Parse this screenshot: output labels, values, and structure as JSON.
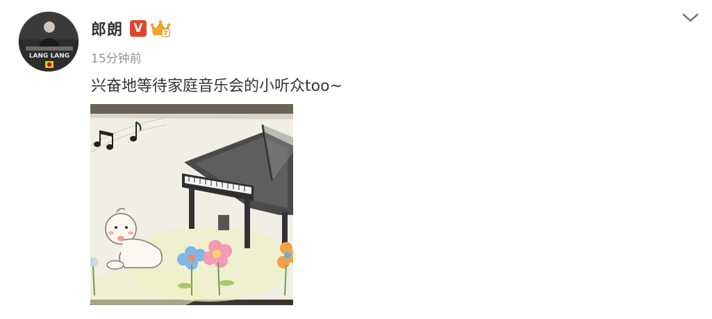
{
  "post": {
    "author": {
      "name": "郎朗",
      "avatar_text": "LANG LANG",
      "verified_badge": "V",
      "verified_icon": "verified-v-icon",
      "member_icon": "crown-icon"
    },
    "timestamp": "15分钟前",
    "text": "兴奋地等待家庭音乐会的小听众too~",
    "image": {
      "alt": "儿童画：钢琴、音符、婴儿与花朵"
    },
    "more_icon": "chevron-down-icon"
  },
  "colors": {
    "author_text": "#333333",
    "timestamp_text": "#939393",
    "verified_badge": "#e3452b",
    "crown": "#f5a623",
    "chevron": "#7a7a7a"
  }
}
